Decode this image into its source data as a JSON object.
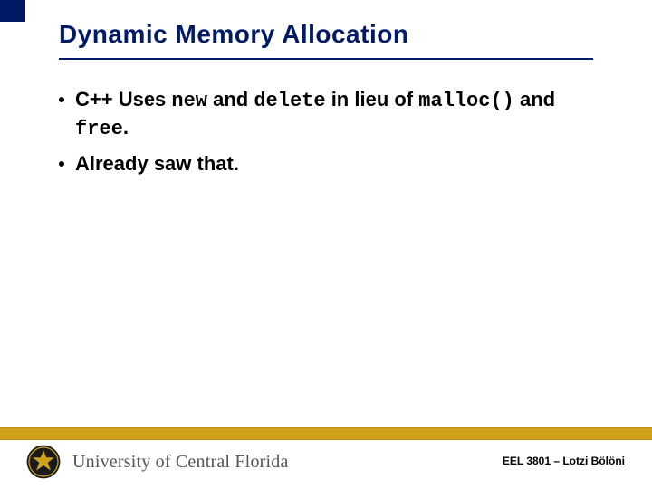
{
  "title": "Dynamic Memory Allocation",
  "bullets": {
    "b1": {
      "pre": "C++ Uses ",
      "kw1": "new",
      "mid1": " and ",
      "kw2": "delete",
      "mid2": " in lieu of ",
      "kw3": "malloc()",
      "mid3": " and ",
      "kw4": "free",
      "post": "."
    },
    "b2": "Already saw that."
  },
  "footer": {
    "university": "University of Central Florida",
    "credit": "EEL 3801 – Lotzi Bölöni"
  },
  "colors": {
    "accent_navy": "#001a66",
    "gold": "#cfa21a"
  }
}
